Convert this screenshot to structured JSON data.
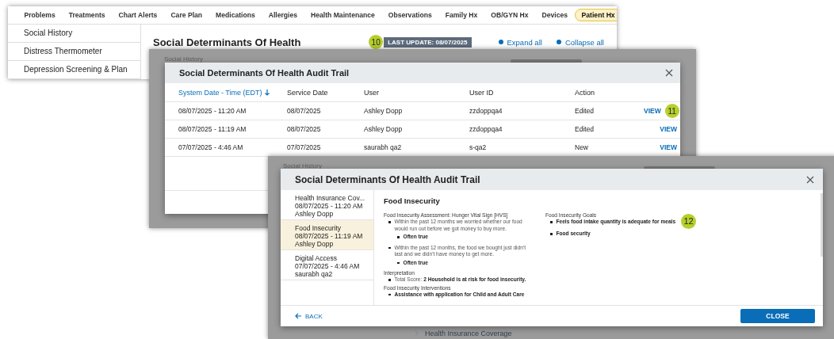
{
  "main_screen": {
    "tabs": [
      {
        "label": "Problems",
        "selected": false
      },
      {
        "label": "Treatments",
        "selected": false
      },
      {
        "label": "Chart Alerts",
        "selected": false
      },
      {
        "label": "Care Plan",
        "selected": false
      },
      {
        "label": "Medications",
        "selected": false
      },
      {
        "label": "Allergies",
        "selected": false
      },
      {
        "label": "Health Maintenance",
        "selected": false
      },
      {
        "label": "Observations",
        "selected": false
      },
      {
        "label": "Family Hx",
        "selected": false
      },
      {
        "label": "OB/GYN Hx",
        "selected": false
      },
      {
        "label": "Devices",
        "selected": false
      },
      {
        "label": "Patient Hx",
        "selected": true
      }
    ],
    "sidebar": {
      "items": [
        "Social History",
        "Distress Thermometer",
        "Depression Screening & Plan"
      ]
    },
    "title": "Social Determinants Of Health",
    "callout": "10",
    "last_update": "LAST UPDATE: 08/07/2025",
    "expand_all": "Expand all",
    "collapse_all": "Collapse all"
  },
  "audit_trail_screen": {
    "background_label": "Social History",
    "dialog": {
      "title": "Social Determinants Of Health Audit Trail",
      "columns": [
        {
          "label": "System Date - Time (EDT)",
          "sorted": true
        },
        {
          "label": "Service Date",
          "sorted": false
        },
        {
          "label": "User",
          "sorted": false
        },
        {
          "label": "User ID",
          "sorted": false
        },
        {
          "label": "Action",
          "sorted": false
        }
      ],
      "rows": [
        {
          "cells": [
            "08/07/2025 - 11:20 AM",
            "08/07/2025",
            "Ashley Dopp",
            "zzdoppqa4",
            "Edited"
          ],
          "link": "VIEW",
          "callout": "11"
        },
        {
          "cells": [
            "08/07/2025 - 11:19 AM",
            "08/07/2025",
            "Ashley Dopp",
            "zzdoppqa4",
            "Edited"
          ],
          "link": "VIEW"
        },
        {
          "cells": [
            "07/07/2025 - 4:46 AM",
            "07/07/2025",
            "saurabh qa2",
            "s-qa2",
            "New"
          ],
          "link": "VIEW"
        }
      ]
    }
  },
  "detail_screen": {
    "background_label": "Social History",
    "background_section": "Health Insurance Coverage",
    "dialog": {
      "title": "Social Determinants Of Health Audit Trail",
      "entries": [
        {
          "lines": [
            "Health Insurance Cov...",
            "08/07/2025 - 11:20 AM",
            "Ashley Dopp"
          ],
          "selected": false
        },
        {
          "lines": [
            "Food Insecurity",
            "08/07/2025 - 11:19 AM",
            "Ashley Dopp"
          ],
          "selected": true
        },
        {
          "lines": [
            "Digital Access",
            "07/07/2025 - 4:46 AM",
            "saurabh qa2"
          ],
          "selected": false
        }
      ],
      "section_title": "Food Insecurity",
      "left_column": [
        {
          "kind": "heading",
          "text": "Food Insecurity Assessment: Hunger Vital Sign [HVS]"
        },
        {
          "kind": "question",
          "text": "Within the past 12 months we worried whether our food would run out before we got money to buy more.",
          "answer": "Often true"
        },
        {
          "kind": "question",
          "text": "Within the past 12 months, the food we bought just didn't last and we didn't have money to get more.",
          "answer": "Often true"
        },
        {
          "kind": "heading",
          "text": "Interpretation"
        },
        {
          "kind": "bullet",
          "text": "Total Score: **2 Household is at risk for food insecurity.**"
        },
        {
          "kind": "heading",
          "text": "Food Insecurity Interventions"
        },
        {
          "kind": "strong_bullet",
          "text": "Assistance with application for Child and Adult Care"
        }
      ],
      "right_column": [
        {
          "kind": "heading",
          "text": "Food Insecurity Goals"
        },
        {
          "kind": "strong_bullet",
          "text": "Feels food intake quantity is adequate for meals",
          "callout": "12"
        },
        {
          "kind": "strong_bullet",
          "text": "Food security"
        }
      ],
      "back": "BACK",
      "close": "CLOSE"
    }
  }
}
